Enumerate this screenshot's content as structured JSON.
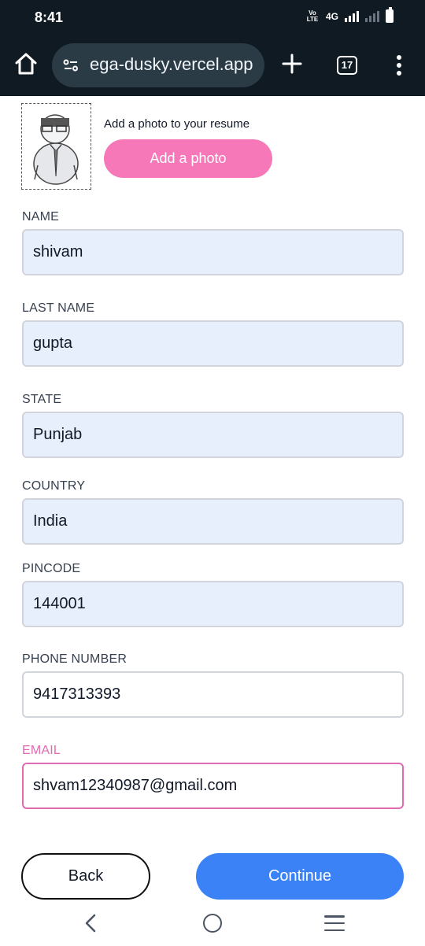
{
  "status_bar": {
    "time": "8:41",
    "network": "4G",
    "volte": "Vo LTE"
  },
  "browser": {
    "url": "ega-dusky.vercel.app",
    "tab_count": "17"
  },
  "photo": {
    "caption": "Add a photo to your resume",
    "button_label": "Add a photo"
  },
  "form": {
    "name": {
      "label": "NAME",
      "value": "shivam"
    },
    "last_name": {
      "label": "LAST NAME",
      "value": "gupta"
    },
    "state": {
      "label": "STATE",
      "value": "Punjab"
    },
    "country": {
      "label": "COUNTRY",
      "value": "India"
    },
    "pincode": {
      "label": "PINCODE",
      "value": "144001"
    },
    "phone": {
      "label": "PHONE NUMBER",
      "value": "9417313393"
    },
    "email": {
      "label": "EMAIL",
      "value": "shvam12340987@gmail.com"
    }
  },
  "actions": {
    "back_label": "Back",
    "continue_label": "Continue"
  },
  "colors": {
    "accent_pink": "#f778b8",
    "primary_blue": "#3b82f6",
    "autofill_bg": "#e8effc",
    "chrome_bg": "#0f1a22"
  },
  "icons": [
    "home-icon",
    "site-settings-icon",
    "plus-icon",
    "tabs-icon",
    "more-vert-icon",
    "nav-back-icon",
    "nav-home-icon",
    "nav-recents-icon",
    "avatar-placeholder"
  ]
}
